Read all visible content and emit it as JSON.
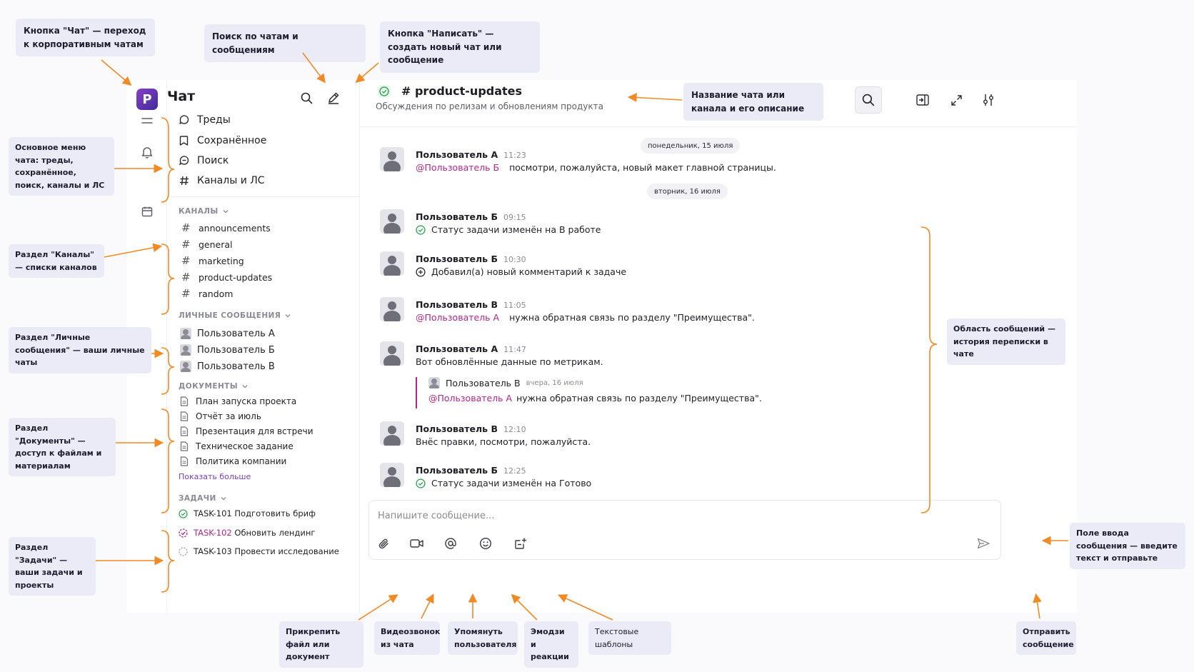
{
  "app": {
    "logo_letter": "P",
    "title": "Чат",
    "nav": [
      {
        "label": "Треды",
        "icon": "threads-icon"
      },
      {
        "label": "Сохранённое",
        "icon": "bookmark-icon"
      },
      {
        "label": "Поиск",
        "icon": "search-icon"
      },
      {
        "label": "Каналы и ЛС",
        "icon": "hash-icon"
      }
    ],
    "channels_header": "КАНАЛЫ",
    "channels": [
      "announcements",
      "general",
      "marketing",
      "product-updates",
      "random"
    ],
    "dm_header": "ЛИЧНЫЕ СООБЩЕНИЯ",
    "dms": [
      "Пользователь А",
      "Пользователь Б",
      "Пользователь В"
    ],
    "docs_header": "ДОКУМЕНТЫ",
    "docs": [
      "План запуска проекта",
      "Отчёт за июль",
      "Презентация для встречи",
      "Техническое задание",
      "Политика компании"
    ],
    "docs_more": "Показать больше",
    "tasks_header": "ЗАДАЧИ",
    "tasks": [
      {
        "id": "TASK-101",
        "title": "Подготовить бриф",
        "status": "done"
      },
      {
        "id": "TASK-102",
        "title": "Обновить лендинг",
        "status": "in-progress"
      },
      {
        "id": "TASK-103",
        "title": "Провести исследование",
        "status": "todo"
      }
    ]
  },
  "channel": {
    "name": "# product-updates",
    "description": "Обсуждения по релизам и обновлениям продукта"
  },
  "dates": [
    "понедельник, 15 июля",
    "вторник, 16 июля"
  ],
  "messages": [
    {
      "author": "Пользователь А",
      "time": "11:23",
      "mention": "@Пользователь Б",
      "text": "посмотри, пожалуйста, новый макет главной страницы."
    },
    {
      "author": "Пользователь Б",
      "time": "09:15",
      "icon": "check-circle-icon",
      "text": "Статус задачи изменён на В работе"
    },
    {
      "author": "Пользователь Б",
      "time": "10:30",
      "icon": "plus-circle-icon",
      "text": "Добавил(а) новый комментарий к задаче"
    },
    {
      "author": "Пользователь В",
      "time": "11:05",
      "mention": "@Пользователь А",
      "text": "нужна обратная связь по разделу \"Преимущества\"."
    },
    {
      "author": "Пользователь А",
      "time": "11:47",
      "text": "Вот обновлённые данные по метрикам.",
      "quote": {
        "author": "Пользователь В",
        "time": "вчера, 16 июля",
        "mention": "@Пользователь А",
        "text": "нужна обратная связь по разделу \"Преимущества\"."
      }
    },
    {
      "author": "Пользователь В",
      "time": "12:10",
      "text": "Внёс правки, посмотри, пожалуйста."
    },
    {
      "author": "Пользователь Б",
      "time": "12:25",
      "icon": "check-circle-icon",
      "text": "Статус задачи изменён на Готово"
    }
  ],
  "composer": {
    "placeholder": "Напишите сообщение..."
  },
  "callouts": {
    "chat_button": "Кнопка \"Чат\" — переход к корпоративным чатам",
    "search": "Поиск по чатам и сообщениям",
    "write_button": "Кнопка \"Написать\" — создать новый чат или сообщение",
    "channel_name": "Название чата или канала и его описание",
    "main_menu": "Основное меню чата: треды, сохранённое, поиск, каналы и ЛС",
    "channels": "Раздел \"Каналы\" — списки каналов",
    "dms": "Раздел \"Личные сообщения\" — ваши личные чаты",
    "docs": "Раздел \"Документы\" — доступ к файлам и материалам",
    "tasks": "Раздел \"Задачи\" — ваши задачи и проекты",
    "messages_area": "Область сообщений — история переписки в чате",
    "input": "Поле ввода сообщения — введите текст и отправьте",
    "attach": "Прикрепить файл или документ",
    "video": "Видеозвонок из чата",
    "mention": "Упомянуть пользователя",
    "emoji": "Эмодзи и реакции",
    "templates": "Текстовые шаблоны",
    "send": "Отправить сообщение"
  },
  "colors": {
    "accent": "#b2258a",
    "brand": "#6b34b5",
    "callout_bg": "#ebebf8",
    "arrow": "#f08a24",
    "success": "#3aa85a"
  }
}
